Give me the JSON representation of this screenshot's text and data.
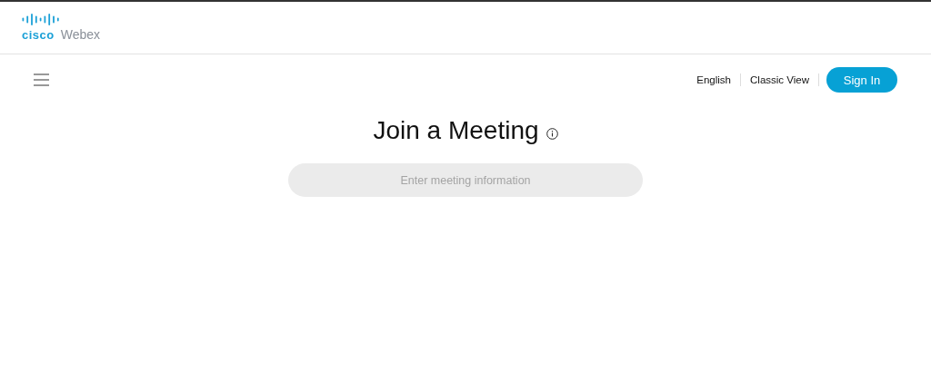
{
  "logo": {
    "brand": "cisco",
    "product": "Webex"
  },
  "nav": {
    "links": [
      {
        "label": "English"
      },
      {
        "label": "Classic View"
      }
    ],
    "sign_in": "Sign In"
  },
  "main": {
    "title": "Join a Meeting",
    "search": {
      "placeholder": "Enter meeting information"
    }
  }
}
